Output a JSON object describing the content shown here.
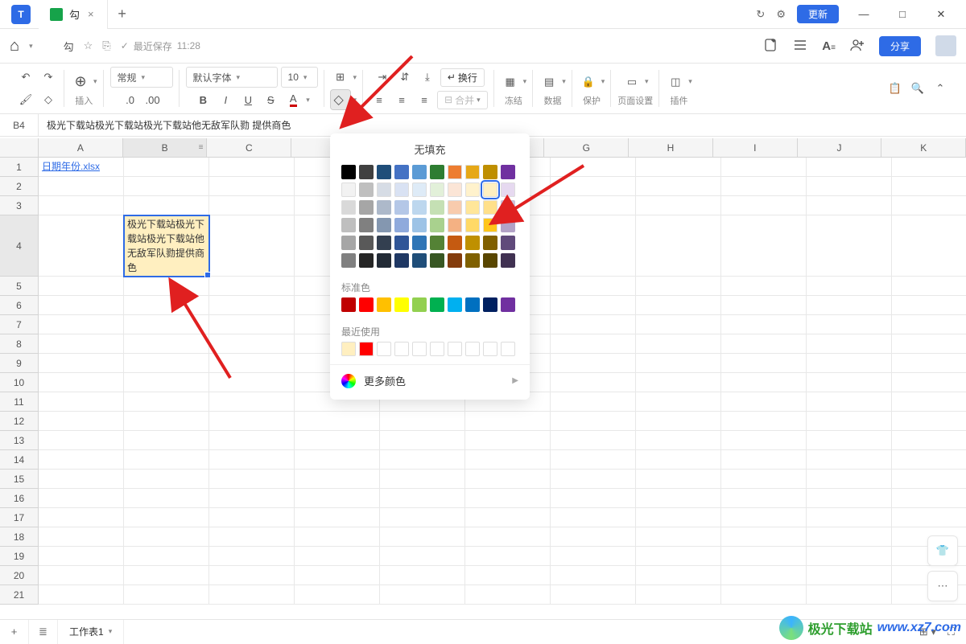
{
  "tab": {
    "title": "勾",
    "close": "×"
  },
  "titlebar": {
    "update": "更新"
  },
  "toolbar": {
    "save_recent": "最近保存",
    "save_time": "11:28",
    "doc_icon_label": "勾",
    "share": "分享"
  },
  "ribbon": {
    "insert": "插入",
    "format_general": "常规",
    "font_default": "默认字体",
    "font_size": "10",
    "decimal_dec": ".0",
    "decimal_inc": ".00",
    "bold": "B",
    "italic": "I",
    "underline": "U",
    "strike": "S",
    "text_color": "A",
    "wrap": "换行",
    "merge": "合并",
    "freeze": "冻结",
    "data": "数据",
    "protect": "保护",
    "page_setup": "页面设置",
    "plugins": "插件"
  },
  "formula": {
    "cell_ref": "B4",
    "value": "极光下载站极光下载站极光下载站他无敌军队勠 提供商色"
  },
  "cols": [
    "A",
    "B",
    "C",
    "",
    "",
    "",
    "G",
    "H",
    "I",
    "J",
    "K"
  ],
  "rows_max": 21,
  "cells": {
    "a1": "日期年份.xlsx",
    "b4": "极光下载站极光下载站极光下载站他无敌军队勠提供商色"
  },
  "picker": {
    "nofill": "无填充",
    "standard": "标准色",
    "recent": "最近使用",
    "more": "更多颜色",
    "theme_rows": [
      [
        "#000000",
        "#404040",
        "#1f4e79",
        "#4472c4",
        "#5b9bd5",
        "#2e7d32",
        "#ed7d31",
        "#e6a817",
        "#bf8f00",
        "#7030a0"
      ],
      [
        "#f2f2f2",
        "#bfbfbf",
        "#d6dce5",
        "#d9e2f3",
        "#deebf7",
        "#e2f0d9",
        "#fbe5d6",
        "#fff2cc",
        "#ffefc0",
        "#e6d9f0"
      ],
      [
        "#d9d9d9",
        "#a6a6a6",
        "#adb9ca",
        "#b4c7e7",
        "#bdd7ee",
        "#c5e0b4",
        "#f8cbad",
        "#ffe699",
        "#ffe08a",
        "#ccc1da"
      ],
      [
        "#bfbfbf",
        "#808080",
        "#8497b0",
        "#8faadc",
        "#9dc3e6",
        "#a9d18e",
        "#f4b183",
        "#ffd966",
        "#ffc61a",
        "#b3a2c7"
      ],
      [
        "#a6a6a6",
        "#595959",
        "#333f50",
        "#2f5597",
        "#2e75b6",
        "#548235",
        "#c55a11",
        "#bf9000",
        "#806000",
        "#604a7b"
      ],
      [
        "#808080",
        "#262626",
        "#222a35",
        "#1f3864",
        "#1f4e79",
        "#385723",
        "#843c0c",
        "#7f6000",
        "#594600",
        "#403152"
      ]
    ],
    "standard_colors": [
      "#c00000",
      "#ff0000",
      "#ffc000",
      "#ffff00",
      "#92d050",
      "#00b050",
      "#00b0f0",
      "#0070c0",
      "#002060",
      "#7030a0"
    ],
    "recent_colors": [
      "#ffefc0",
      "#ff0000",
      "",
      "",
      "",
      "",
      "",
      "",
      "",
      ""
    ]
  },
  "sheets": {
    "sheet1": "工作表1"
  },
  "watermark": {
    "t1": "极光下载站",
    "t2": "www.xz7.com"
  }
}
